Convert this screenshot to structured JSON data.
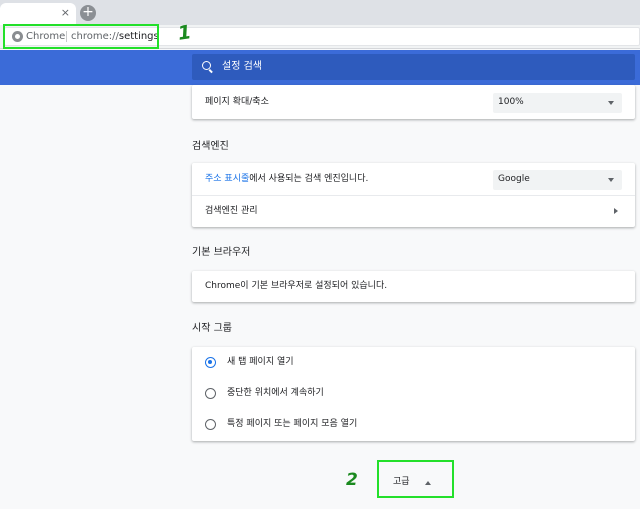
{
  "browser": {
    "tab_close": "×",
    "new_tab": "+",
    "omnibox_chip": "Chrome",
    "url_prefix": "chrome://",
    "url_path": "settings"
  },
  "header": {
    "search_placeholder": "설정 검색",
    "accent": "#3b6bd8"
  },
  "zoom": {
    "label": "페이지 확대/축소",
    "value": "100%"
  },
  "search_engine": {
    "title": "검색엔진",
    "row_link": "주소 표시줄",
    "row_rest": "에서 사용되는 검색 엔진입니다.",
    "value": "Google",
    "manage_label": "검색엔진 관리"
  },
  "default_browser": {
    "title": "기본 브라우저",
    "status": "Chrome이 기본 브라우저로 설정되어 있습니다."
  },
  "startup": {
    "title": "시작 그룹",
    "options": [
      {
        "label": "새 탭 페이지 열기",
        "checked": true
      },
      {
        "label": "중단한 위치에서 계속하기",
        "checked": false
      },
      {
        "label": "특정 페이지 또는 페이지 모음 열기",
        "checked": false
      }
    ]
  },
  "advanced": {
    "label": "고급"
  },
  "annotations": {
    "mark1": "1",
    "mark2": "2",
    "highlight_color": "#23e02a"
  }
}
